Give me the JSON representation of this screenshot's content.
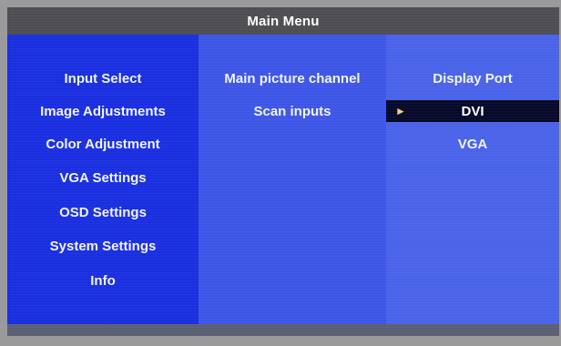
{
  "title": "Main Menu",
  "left_menu": [
    {
      "label": "Input Select"
    },
    {
      "label": "Image Adjustments"
    },
    {
      "label": "Color Adjustment"
    },
    {
      "label": "VGA Settings"
    },
    {
      "label": "OSD Settings"
    },
    {
      "label": "System Settings"
    },
    {
      "label": "Info"
    }
  ],
  "middle_menu": [
    {
      "label": "Main picture channel"
    },
    {
      "label": "Scan inputs"
    }
  ],
  "right_menu": [
    {
      "label": "Display Port",
      "selected": false
    },
    {
      "label": "DVI",
      "selected": true
    },
    {
      "label": "VGA",
      "selected": false
    }
  ],
  "selection_marker": "►",
  "colors": {
    "left_panel": "#1a2fe0",
    "middle_panel": "#3e56e6",
    "right_panel": "#4a63e8",
    "title_bar": "#4d4d52",
    "selected_row": "#07092a",
    "marker": "#f3d27a"
  }
}
